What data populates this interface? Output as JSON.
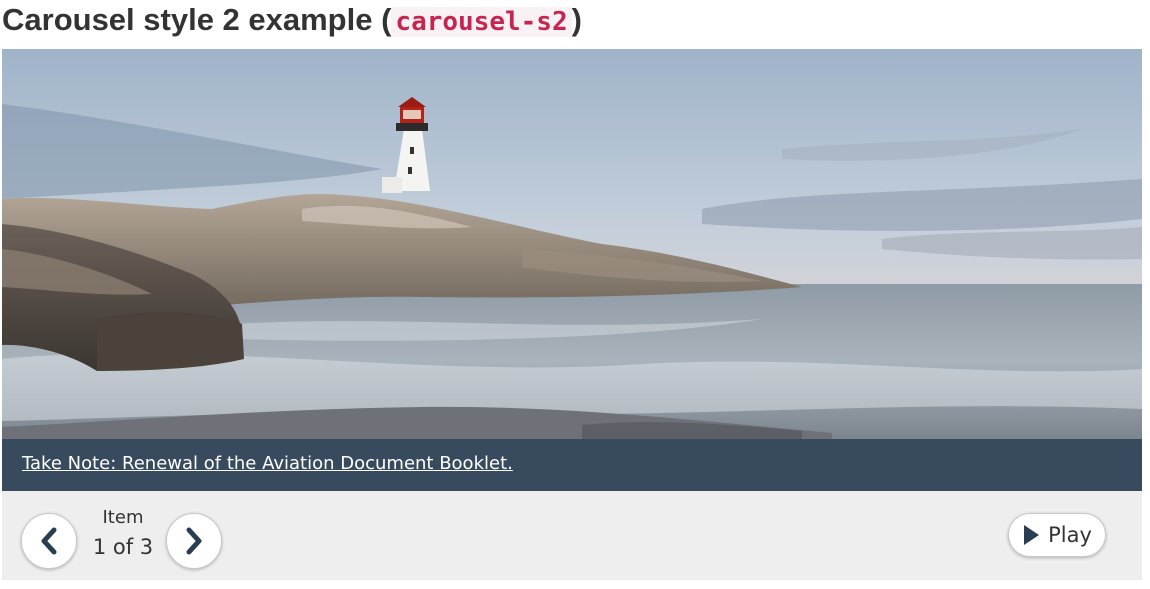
{
  "heading": {
    "text": "Carousel style 2 example (",
    "code": "carousel-s2",
    "suffix": ")"
  },
  "carousel": {
    "image": {
      "description_icon": "lighthouse-photo"
    },
    "caption": {
      "link_text": "Take Note: Renewal of the Aviation Document Booklet."
    },
    "controls": {
      "prev_icon": "chevron-left-icon",
      "next_icon": "chevron-right-icon",
      "item_label": "Item",
      "item_count": "1 of 3",
      "play_label": "Play",
      "play_icon": "play-icon"
    },
    "colors": {
      "caption_background": "#374a5e",
      "controls_background": "#eeeeee",
      "icon_color": "#2a3e52",
      "code_color": "#c7254e"
    }
  }
}
